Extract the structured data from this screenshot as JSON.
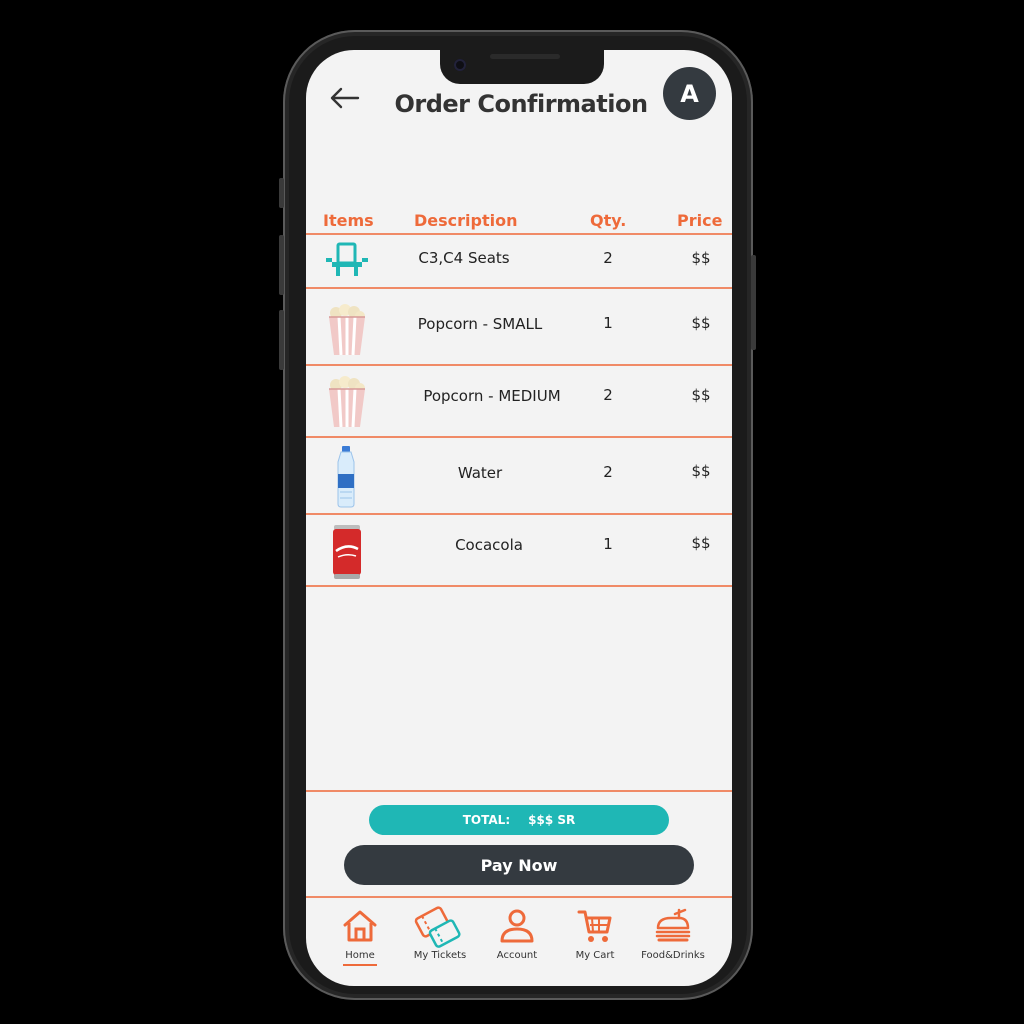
{
  "header": {
    "title": "Order Confirmation",
    "avatar_letter": "A"
  },
  "table": {
    "columns": [
      "Items",
      "Description",
      "Qty.",
      "Price"
    ],
    "rows": [
      {
        "icon": "seat-icon",
        "description": "C3,C4 Seats",
        "qty": "2",
        "price": "$$"
      },
      {
        "icon": "popcorn-icon",
        "description": "Popcorn - SMALL",
        "qty": "1",
        "price": "$$"
      },
      {
        "icon": "popcorn-icon",
        "description": "Popcorn - MEDIUM",
        "qty": "2",
        "price": "$$"
      },
      {
        "icon": "water-bottle-icon",
        "description": "Water",
        "qty": "2",
        "price": "$$"
      },
      {
        "icon": "cola-can-icon",
        "description": "Cocacola",
        "qty": "1",
        "price": "$$"
      }
    ]
  },
  "total": {
    "label": "TOTAL:",
    "value": "$$$ SR"
  },
  "pay_button": "Pay Now",
  "nav": [
    {
      "label": "Home",
      "icon": "home-icon",
      "active": true
    },
    {
      "label": "My Tickets",
      "icon": "tickets-icon",
      "active": false
    },
    {
      "label": "Account",
      "icon": "account-icon",
      "active": false
    },
    {
      "label": "My Cart",
      "icon": "cart-icon",
      "active": false
    },
    {
      "label": "Food&Drinks",
      "icon": "food-drinks-icon",
      "active": false
    }
  ],
  "colors": {
    "accent": "#ee6a3a",
    "teal": "#1fb7b5",
    "dark": "#343a40",
    "background": "#f3f3f3"
  }
}
